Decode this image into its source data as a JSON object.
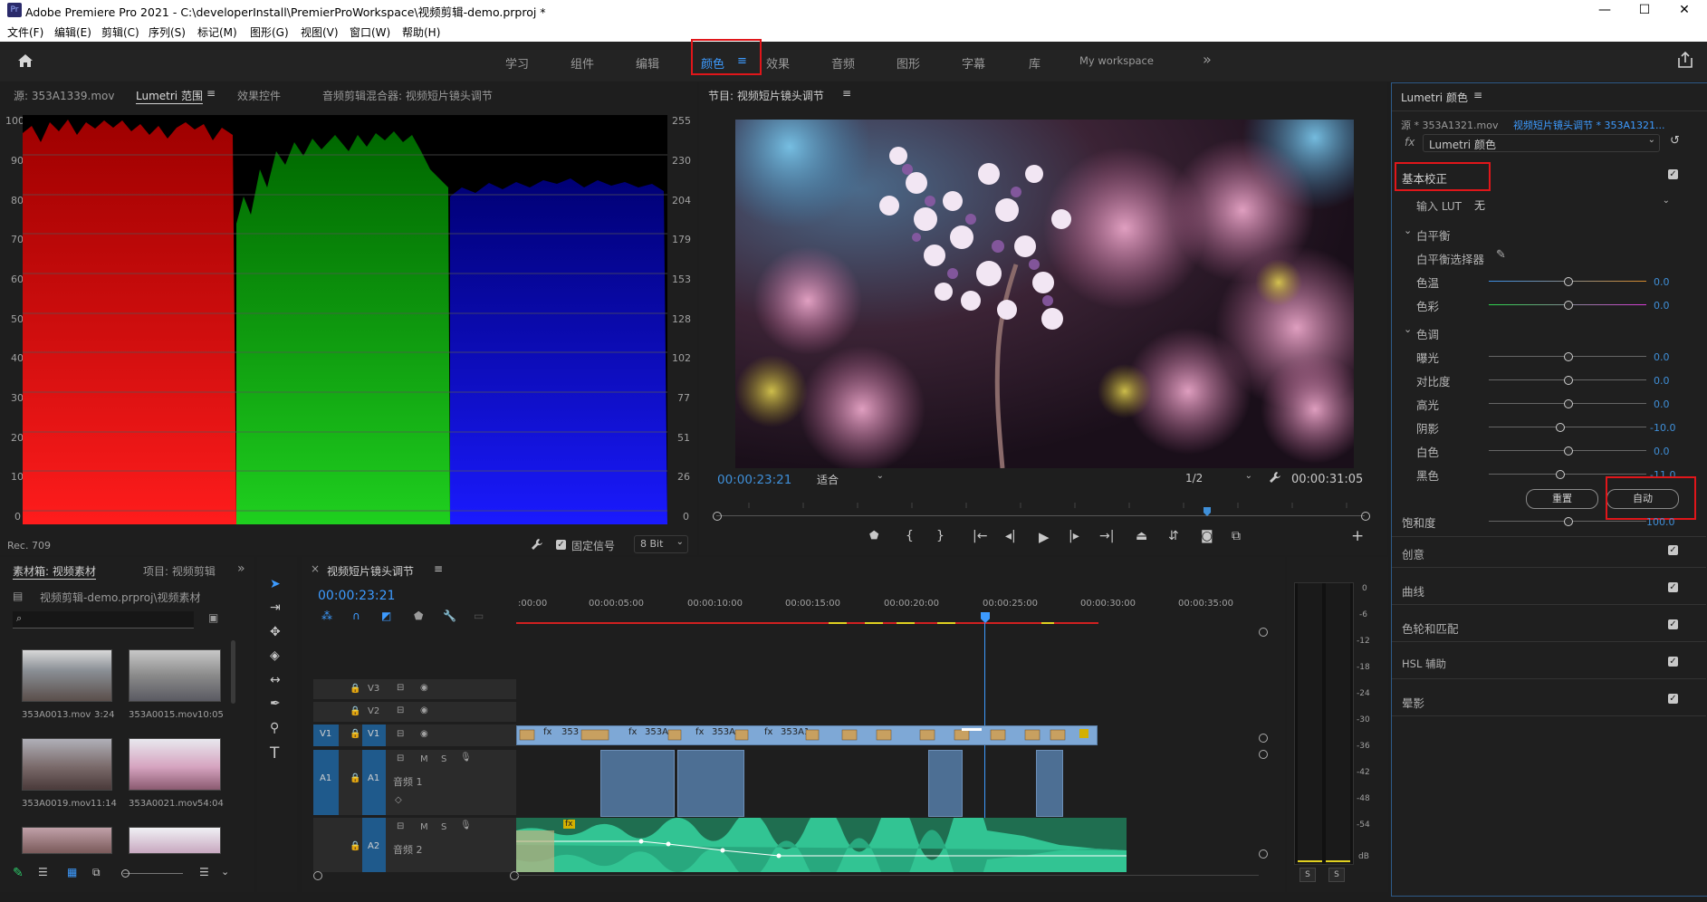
{
  "window": {
    "app_icon": "Pr",
    "title": "Adobe Premiere Pro 2021 - C:\\developerInstall\\PremierProWorkspace\\视频剪辑-demo.prproj *",
    "minimize": "—",
    "maximize": "☐",
    "close": "✕"
  },
  "menu": [
    "文件(F)",
    "编辑(E)",
    "剪辑(C)",
    "序列(S)",
    "标记(M)",
    "图形(G)",
    "视图(V)",
    "窗口(W)",
    "帮助(H)"
  ],
  "workspaces": {
    "items": [
      "学习",
      "组件",
      "编辑",
      "颜色",
      "效果",
      "音频",
      "图形",
      "字幕",
      "库",
      "My workspace"
    ],
    "active": "颜色",
    "menu_icon": "≡",
    "more": "»"
  },
  "source_panel": {
    "tabs": [
      "源: 353A1339.mov",
      "Lumetri 范围",
      "效果控件",
      "音频剪辑混合器: 视频短片镜头调节"
    ],
    "menu_icon": "≡",
    "y_left": [
      "100",
      "90",
      "80",
      "70",
      "60",
      "50",
      "40",
      "30",
      "20",
      "10",
      "0"
    ],
    "y_right": [
      "255",
      "230",
      "204",
      "179",
      "153",
      "128",
      "102",
      "77",
      "51",
      "26",
      "0"
    ],
    "footer_left": "Rec. 709",
    "clamp_label": "固定信号",
    "bit_depth": "8 Bit"
  },
  "program": {
    "title": "节目: 视频短片镜头调节",
    "menu_icon": "≡",
    "timecode": "00:00:23:21",
    "fit": "适合",
    "resolution": "1/2",
    "duration": "00:00:31:05",
    "playhead_fraction": 0.757,
    "controls": [
      "marker-icon",
      "mark-in-icon",
      "mark-out-icon",
      "go-to-in-icon",
      "step-back-icon",
      "play-icon",
      "step-forward-icon",
      "go-to-out-icon",
      "lift-icon",
      "extract-icon",
      "export-frame-icon",
      "comparison-view-icon"
    ]
  },
  "lumetri": {
    "title": "Lumetri 颜色",
    "menu_icon": "≡",
    "source_clip": "源 * 353A1321.mov",
    "sequence_clip": "视频短片镜头调节 * 353A1321...",
    "fx_label": "fx",
    "effect_name": "Lumetri 颜色",
    "basic_section": "基本校正",
    "input_lut_label": "输入 LUT",
    "input_lut_value": "无",
    "white_balance": "白平衡",
    "wb_selector": "白平衡选择器",
    "tone": "色调",
    "sliders": [
      {
        "label": "色温",
        "value": "0.0",
        "pos": 0.5
      },
      {
        "label": "色彩",
        "value": "0.0",
        "pos": 0.5
      },
      {
        "label": "曝光",
        "value": "0.0",
        "pos": 0.5
      },
      {
        "label": "对比度",
        "value": "0.0",
        "pos": 0.5
      },
      {
        "label": "高光",
        "value": "0.0",
        "pos": 0.5
      },
      {
        "label": "阴影",
        "value": "-10.0",
        "pos": 0.45
      },
      {
        "label": "白色",
        "value": "0.0",
        "pos": 0.5
      },
      {
        "label": "黑色",
        "value": "-11.0",
        "pos": 0.45
      },
      {
        "label": "饱和度",
        "value": "100.0",
        "pos": 0.5
      }
    ],
    "reset_button": "重置",
    "auto_button": "自动",
    "sections": [
      "创意",
      "曲线",
      "色轮和匹配",
      "HSL 辅助",
      "晕影"
    ]
  },
  "project": {
    "tabs": [
      "素材箱: 视频素材",
      "项目: 视频剪辑"
    ],
    "more": "»",
    "path": "视频剪辑-demo.prproj\\视频素材",
    "search_placeholder": "",
    "items": [
      {
        "name": "353A0013.mov",
        "duration": "3:24"
      },
      {
        "name": "353A0015.mov",
        "duration": "10:05"
      },
      {
        "name": "353A0019.mov",
        "duration": "11:14"
      },
      {
        "name": "353A0021.mov",
        "duration": "54:04"
      }
    ]
  },
  "timeline": {
    "title": "视频短片镜头调节",
    "close": "×",
    "menu_icon": "≡",
    "timecode": "00:00:23:21",
    "ruler": [
      ":00:00",
      "00:00:05:00",
      "00:00:10:00",
      "00:00:15:00",
      "00:00:20:00",
      "00:00:25:00",
      "00:00:30:00",
      "00:00:35:00"
    ],
    "tracks": {
      "v3": "V3",
      "v2": "V2",
      "v1": "V1",
      "v1_src": "V1",
      "a1": "A1",
      "a1_src": "A1",
      "a1_name": "音频 1",
      "a2": "A2",
      "a2_name": "音频 2",
      "m": "M",
      "s": "S"
    },
    "clip_labels": [
      "353",
      "353A",
      "353A",
      "353A1"
    ],
    "fx_badge": "fx",
    "audio_fx": "fx"
  },
  "meter": {
    "scale": [
      "0",
      "-6",
      "-12",
      "-18",
      "-24",
      "-30",
      "-36",
      "-42",
      "-48",
      "-54",
      "dB"
    ],
    "solo_left": "S",
    "solo_right": "S"
  },
  "colors": {
    "accent": "#2d8ceb",
    "highlight_box": "#e0161a",
    "clip_video": "#7ea8d6",
    "clip_audio": "#2fb98a"
  }
}
